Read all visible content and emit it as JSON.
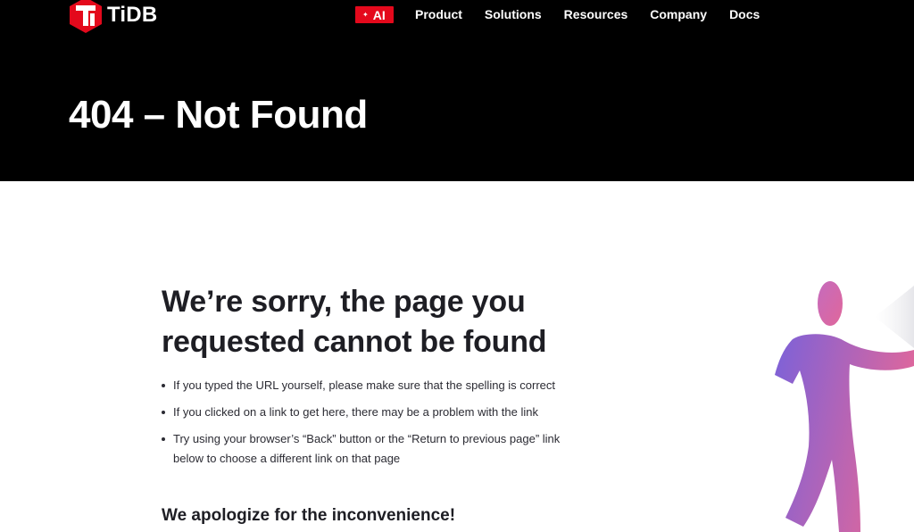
{
  "brand": {
    "name": "TiDB",
    "accent": "#e4091c"
  },
  "nav": {
    "ai_label": "AI",
    "items": [
      "Product",
      "Solutions",
      "Resources",
      "Company",
      "Docs"
    ]
  },
  "hero": {
    "title": "404 – Not Found"
  },
  "content": {
    "headline": "We’re sorry, the page you requested cannot be found",
    "bullets": [
      "If you typed the URL yourself, please make sure that the spelling is correct",
      "If you clicked on a link to get here, there may be a problem with the link",
      "Try using your browser’s “Back” button or the “Return to previous page” link below to choose a different link on that page"
    ],
    "apology": "We apologize for the inconvenience!"
  },
  "colors": {
    "hero_bg": "#000000",
    "text": "#1e1e24",
    "figure_gradient": [
      "#7b61d9",
      "#e0679b"
    ]
  }
}
